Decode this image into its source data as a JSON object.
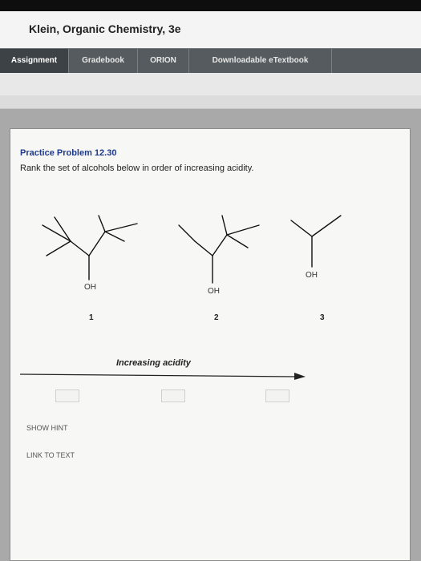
{
  "header": {
    "title": "Klein, Organic Chemistry, 3e"
  },
  "nav": {
    "tabs": [
      {
        "label": "Assignment",
        "active": true
      },
      {
        "label": "Gradebook",
        "active": false
      },
      {
        "label": "ORION",
        "active": false
      },
      {
        "label": "Downloadable eTextbook",
        "active": false
      }
    ]
  },
  "problem": {
    "title": "Practice Problem 12.30",
    "prompt": "Rank the set of alcohols below in order of increasing acidity.",
    "structures": [
      {
        "number": "1",
        "oh_label": "OH"
      },
      {
        "number": "2",
        "oh_label": "OH"
      },
      {
        "number": "3",
        "oh_label": "OH"
      }
    ],
    "arrow_label": "Increasing acidity"
  },
  "actions": {
    "show_hint": "SHOW HINT",
    "link_to_text": "LINK TO TEXT"
  }
}
